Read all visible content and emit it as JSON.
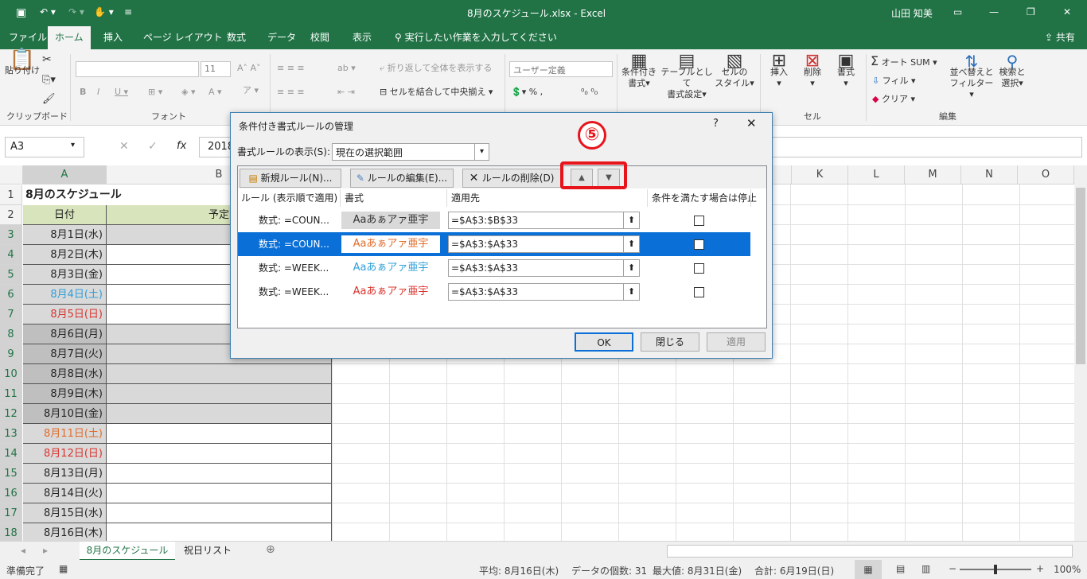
{
  "window": {
    "title": "8月のスケジュール.xlsx  -  Excel",
    "user": "山田 知美"
  },
  "tabs": [
    "ファイル",
    "ホーム",
    "挿入",
    "ページ レイアウト",
    "数式",
    "データ",
    "校閲",
    "表示"
  ],
  "tell_me": "実行したい作業を入力してください",
  "share": "共有",
  "ribbon": {
    "paste": "貼り付け",
    "clipboard": "クリップボード",
    "font_group": "フォント",
    "font_size": "11",
    "wrap": "折り返して全体を表示する",
    "merge": "セルを結合して中央揃え",
    "number_format": "ユーザー定義",
    "cond_format": "条件付き",
    "cond_format2": "書式",
    "table_format": "テーブルとして",
    "table_format2": "書式設定",
    "cell_style": "セルの",
    "cell_style2": "スタイル",
    "insert": "挿入",
    "delete": "削除",
    "format": "書式",
    "cells_group": "セル",
    "autosum": "オート SUM",
    "fill": "フィル",
    "clear": "クリア",
    "sort": "並べ替えと",
    "sort2": "フィルター",
    "find": "検索と",
    "find2": "選択",
    "editing_group": "編集"
  },
  "formula_bar": {
    "name_box": "A3",
    "formula": "2018"
  },
  "columns": [
    "A",
    "B",
    "K",
    "L",
    "M",
    "N",
    "O"
  ],
  "sheet": {
    "a1": "8月のスケジュール",
    "a2": "日付",
    "b2": "予定",
    "rows": [
      {
        "n": "1"
      },
      {
        "n": "2"
      },
      {
        "n": "3",
        "d": "8月1日(水)"
      },
      {
        "n": "4",
        "d": "8月2日(木)"
      },
      {
        "n": "5",
        "d": "8月3日(金)"
      },
      {
        "n": "6",
        "d": "8月4日(土)"
      },
      {
        "n": "7",
        "d": "8月5日(日)"
      },
      {
        "n": "8",
        "d": "8月6日(月)"
      },
      {
        "n": "9",
        "d": "8月7日(火)"
      },
      {
        "n": "10",
        "d": "8月8日(水)"
      },
      {
        "n": "11",
        "d": "8月9日(木)"
      },
      {
        "n": "12",
        "d": "8月10日(金)"
      },
      {
        "n": "13",
        "d": "8月11日(土)"
      },
      {
        "n": "14",
        "d": "8月12日(日)"
      },
      {
        "n": "15",
        "d": "8月13日(月)"
      },
      {
        "n": "16",
        "d": "8月14日(火)"
      },
      {
        "n": "17",
        "d": "8月15日(水)"
      },
      {
        "n": "18",
        "d": "8月16日(木)"
      }
    ]
  },
  "sheet_tabs": [
    "8月のスケジュール",
    "祝日リスト"
  ],
  "status": {
    "ready": "準備完了",
    "avg": "平均: 8月16日(木)",
    "count": "データの個数: 31",
    "max": "最大値: 8月31日(金)",
    "sum": "合計: 6月19日(日)",
    "zoom": "100%"
  },
  "dialog": {
    "title": "条件付き書式ルールの管理",
    "help": "?",
    "show_label": "書式ルールの表示(S):",
    "show_value": "現在の選択範囲",
    "new_rule": "新規ルール(N)...",
    "edit_rule": "ルールの編集(E)...",
    "delete_rule": "ルールの削除(D)",
    "col_rule": "ルール (表示順で適用)",
    "col_format": "書式",
    "col_applies": "適用先",
    "col_stop": "条件を満たす場合は停止",
    "rules": [
      {
        "rule": "数式: =COUN...",
        "preview": "Aaあぁアァ亜宇",
        "applies": "=$A$3:$B$33"
      },
      {
        "rule": "数式: =COUN...",
        "preview": "Aaあぁアァ亜宇",
        "applies": "=$A$3:$A$33"
      },
      {
        "rule": "数式: =WEEK...",
        "preview": "Aaあぁアァ亜宇",
        "applies": "=$A$3:$A$33"
      },
      {
        "rule": "数式: =WEEK...",
        "preview": "Aaあぁアァ亜宇",
        "applies": "=$A$3:$A$33"
      }
    ],
    "ok": "OK",
    "close": "閉じる",
    "apply": "適用"
  },
  "annotation": "⑤",
  "colors": {
    "excel_green": "#217346",
    "highlight_red": "#e8141b",
    "selected_blue": "#0a6fd6",
    "sat_blue": "#2e9fd8",
    "sun_red": "#d9332d",
    "orange": "#e06c2a"
  }
}
